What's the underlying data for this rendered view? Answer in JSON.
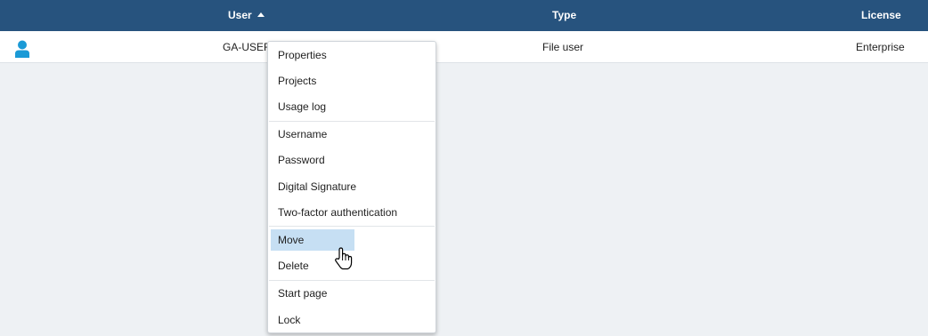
{
  "table": {
    "columns": [
      {
        "label": "User",
        "sort": "ascending"
      },
      {
        "label": "Type"
      },
      {
        "label": "License"
      }
    ],
    "rows": [
      {
        "icon": "user-icon",
        "user": "GA-USER",
        "type": "File user",
        "license": "Enterprise"
      }
    ]
  },
  "context_menu": {
    "groups": [
      [
        "Properties",
        "Projects",
        "Usage log"
      ],
      [
        "Username",
        "Password",
        "Digital Signature",
        "Two-factor authentication"
      ],
      [
        "Move",
        "Delete"
      ],
      [
        "Start page",
        "Lock"
      ]
    ],
    "highlighted": "Move"
  },
  "colors": {
    "header_bg": "#27537e",
    "page_bg": "#eef1f4",
    "user_icon": "#1b9ad6",
    "highlight": "#c6dff3"
  }
}
